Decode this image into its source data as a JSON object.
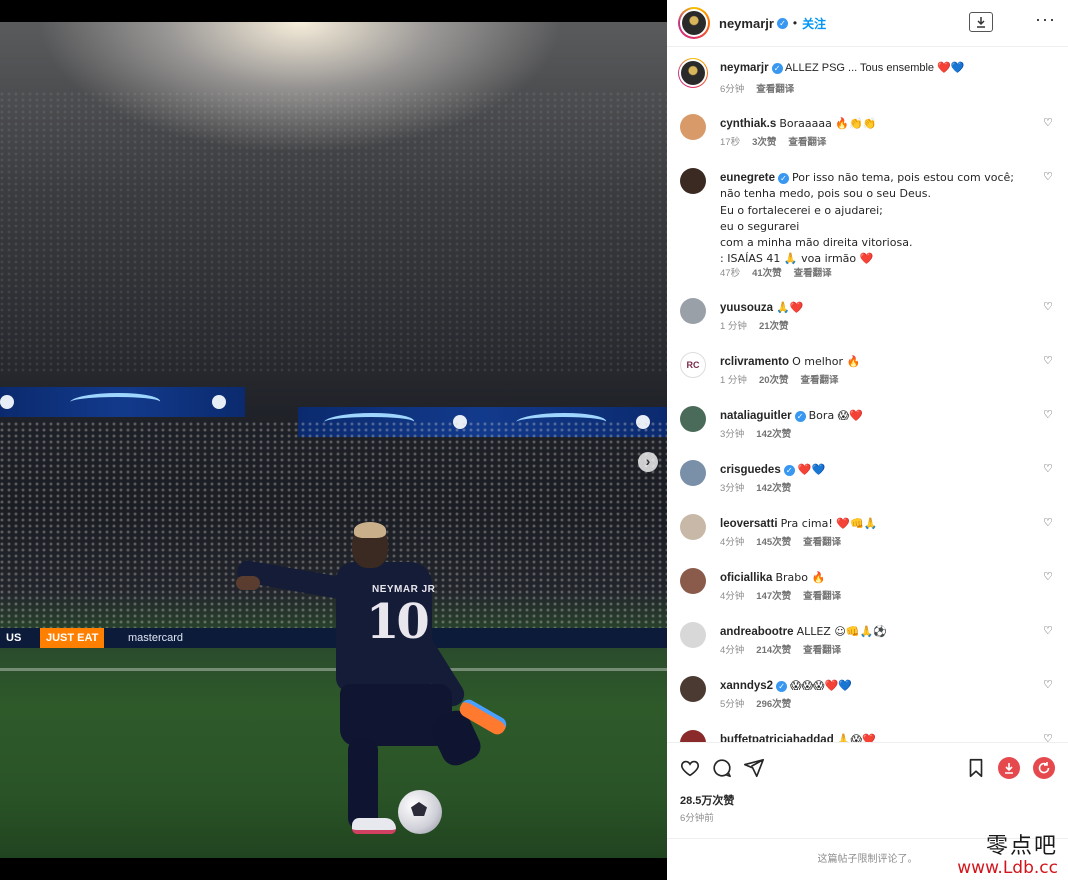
{
  "colors": {
    "accent": "#0095f6",
    "verified": "#3897f0",
    "heart_red": "#ed4956",
    "watermark_red": "#d2151b"
  },
  "photo": {
    "jersey_name": "NEYMAR JR",
    "jersey_number": "10",
    "ad_text_1": "JUST EAT",
    "ad_text_2": "mastercard",
    "ad_text_3": "US"
  },
  "carousel": {
    "next_icon": "chevron-right-icon",
    "dot_count": 2,
    "active_dot": 0
  },
  "header": {
    "username": "neymarjr",
    "separator": "•",
    "follow_label": "关注",
    "download_icon": "download-icon",
    "more_icon": "more-icon",
    "more_label": "···"
  },
  "caption": {
    "username": "neymarjr",
    "text": "ALLEZ PSG ... Tous ensemble ❤️💙",
    "time": "6分钟",
    "translate": "查看翻译"
  },
  "comments": [
    {
      "user": "cynthiak.s",
      "verified": false,
      "text": "Boraaaaa 🔥👏👏",
      "time": "17秒",
      "likes": "3次赞",
      "translate": "查看翻译",
      "avatar_color": "#d99a6a"
    },
    {
      "user": "eunegrete",
      "verified": true,
      "lines": [
        "Por isso não tema, pois estou com você;",
        "não tenha medo, pois sou o seu Deus.",
        "Eu o fortalecerei e o ajudarei;",
        "eu o segurarei",
        "com a minha mão direita vitoriosa.",
        ": ISAÍAS 41 🙏 voa irmão ❤️"
      ],
      "time": "47秒",
      "likes": "41次赞",
      "translate": "查看翻译",
      "avatar_color": "#3a2a22"
    },
    {
      "user": "yuusouza",
      "verified": false,
      "text": "🙏❤️",
      "time": "1 分钟",
      "likes": "21次赞",
      "translate": "",
      "avatar_color": "#9aa0a8"
    },
    {
      "user": "rclivramento",
      "verified": false,
      "text": "O melhor 🔥",
      "time": "1 分钟",
      "likes": "20次赞",
      "translate": "查看翻译",
      "avatar_color": "#ffffff",
      "avatar_text": "RC"
    },
    {
      "user": "nataliaguitler",
      "verified": true,
      "text": "Bora 😱❤️",
      "time": "3分钟",
      "likes": "142次赞",
      "translate": "",
      "avatar_color": "#4a6a5a"
    },
    {
      "user": "crisguedes",
      "verified": true,
      "text": "❤️💙",
      "time": "3分钟",
      "likes": "142次赞",
      "translate": "",
      "avatar_color": "#7a8fa8"
    },
    {
      "user": "leoversatti",
      "verified": false,
      "text": "Pra cima! ❤️👊🙏",
      "time": "4分钟",
      "likes": "145次赞",
      "translate": "查看翻译",
      "avatar_color": "#c8b8a8"
    },
    {
      "user": "oficiallika",
      "verified": false,
      "text": "Brabo 🔥",
      "time": "4分钟",
      "likes": "147次赞",
      "translate": "查看翻译",
      "avatar_color": "#8a5a4a"
    },
    {
      "user": "andreabootre",
      "verified": false,
      "text": "ALLEZ ☺👊🙏⚽",
      "time": "4分钟",
      "likes": "214次赞",
      "translate": "查看翻译",
      "avatar_color": "#d8d8d8"
    },
    {
      "user": "xanndys2",
      "verified": true,
      "text": "😱😱😱❤️💙",
      "time": "5分钟",
      "likes": "296次赞",
      "translate": "",
      "avatar_color": "#4a3a32"
    },
    {
      "user": "buffetpatriciahaddad",
      "verified": false,
      "text": "🙏😱❤️",
      "time": "",
      "likes": "",
      "translate": "",
      "avatar_color": "#8a2a2a"
    }
  ],
  "actions": {
    "like_icon": "heart-icon",
    "comment_icon": "comment-icon",
    "share_icon": "share-icon",
    "save_icon": "bookmark-icon",
    "ext1_icon": "download-extension-icon",
    "ext2_icon": "refresh-extension-icon",
    "likes_count": "28.5万次赞",
    "posted": "6分钟前"
  },
  "footer_note": "这篇帖子限制评论了。",
  "watermark": {
    "text": "零点吧",
    "url": "www.Ldb.cc"
  }
}
